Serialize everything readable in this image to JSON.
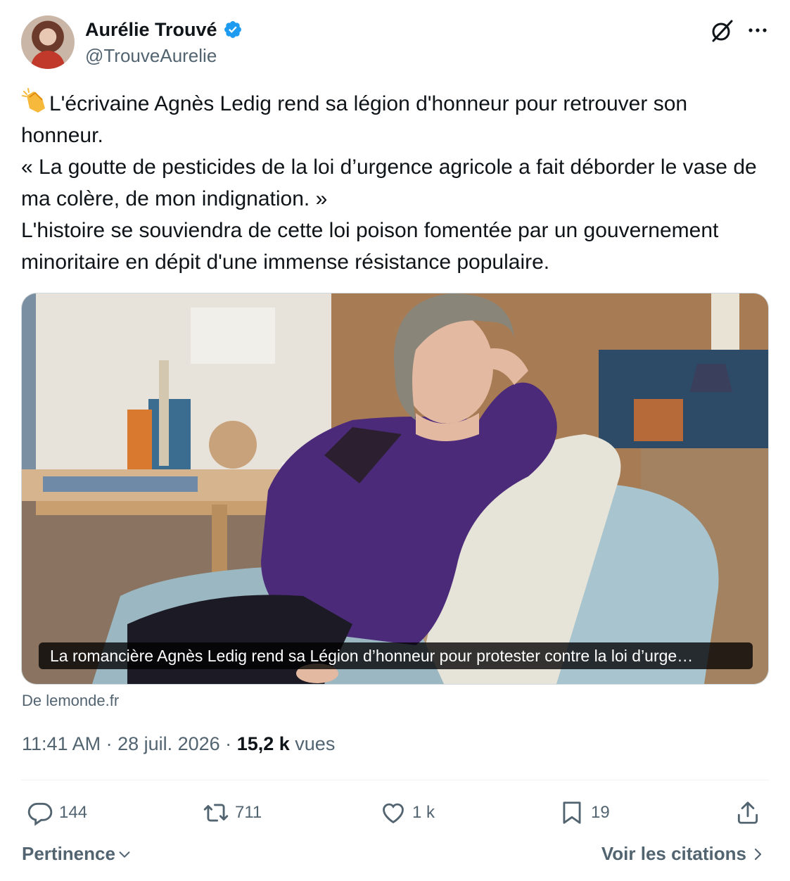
{
  "author": {
    "display_name": "Aurélie Trouvé",
    "handle": "@TrouveAurelie",
    "verified": true
  },
  "tweet": {
    "emoji": "clapping-hands",
    "text": "L'écrivaine Agnès Ledig rend sa légion d'honneur pour retrouver son honneur.\n« La goutte de pesticides de la loi d’urgence agricole a fait déborder le vase de ma colère, de mon indignation. »\nL'histoire se souviendra de cette loi poison fomentée par un gouvernement minoritaire en dépit d'une immense résistance populaire."
  },
  "card": {
    "caption": "La romancière Agnès Ledig rend sa Légion d’honneur pour protester contre la loi d’urge…",
    "source": "De lemonde.fr"
  },
  "meta": {
    "time_date": "11:41 AM · 28 juil. 2026 · ",
    "views_count": "15,2 k",
    "views_label": "vues"
  },
  "actions": {
    "replies": "144",
    "reposts": "711",
    "likes": "1 k",
    "bookmarks": "19"
  },
  "footer": {
    "sort_label": "Pertinence",
    "quotes_label": "Voir les citations"
  },
  "colors": {
    "text": "#0f1419",
    "secondary": "#536471",
    "verified_blue": "#1d9bf0",
    "border": "#cfd9de"
  }
}
